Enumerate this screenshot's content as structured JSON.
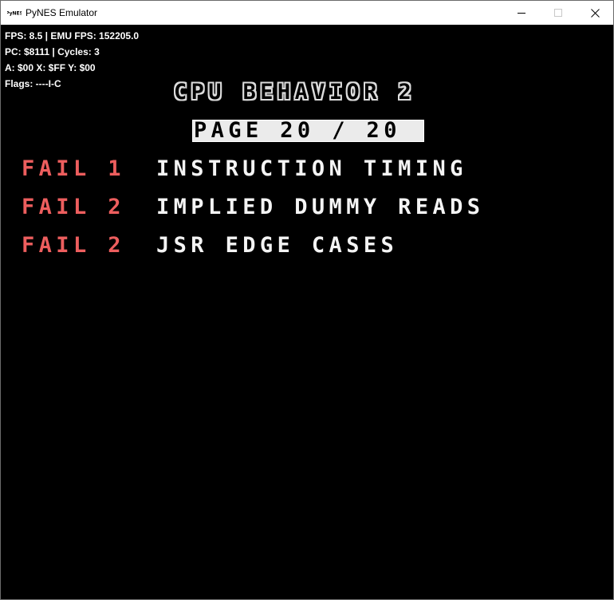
{
  "window": {
    "title": "PyNES Emulator",
    "icon": "pynes-logo-icon",
    "controls": [
      "minimize-icon",
      "maximize-icon",
      "close-icon"
    ]
  },
  "overlay": {
    "fps_line": "FPS: 8.5 | EMU FPS: 152205.0",
    "pc_line": "PC: $8111 | Cycles: 3",
    "reg_line": "A: $00 X: $FF Y: $00",
    "flags_line": "Flags: ----I-C"
  },
  "test_screen": {
    "heading": "CPU BEHAVIOR 2",
    "page_label": "PAGE 20 / 20",
    "results": [
      {
        "status": "FAIL 1",
        "name": "INSTRUCTION TIMING"
      },
      {
        "status": "FAIL 2",
        "name": "IMPLIED DUMMY READS"
      },
      {
        "status": "FAIL 2",
        "name": "JSR EDGE CASES"
      }
    ]
  },
  "colors": {
    "background": "#000000",
    "fail_text": "#ed5e5e",
    "name_text": "#f4f4f4",
    "page_bar": "#ebebeb"
  }
}
